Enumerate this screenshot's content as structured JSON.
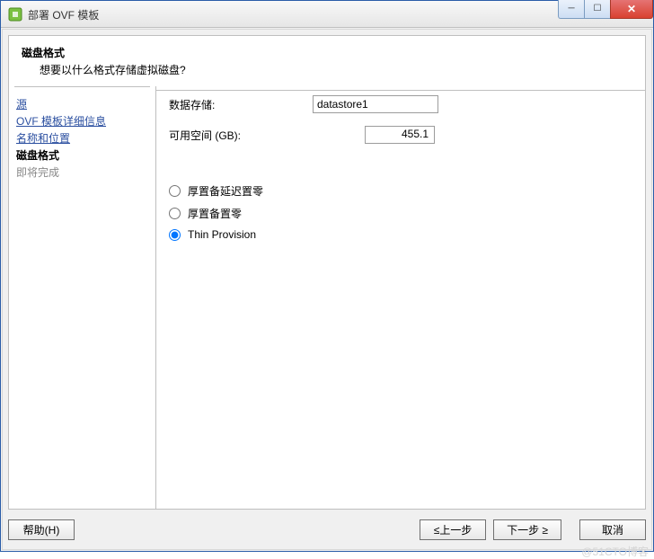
{
  "window": {
    "title": "部署 OVF 模板"
  },
  "header": {
    "title": "磁盘格式",
    "subtitle": "想要以什么格式存储虚拟磁盘?"
  },
  "sidebar": {
    "items": [
      {
        "label": "源",
        "state": "link"
      },
      {
        "label": "OVF 模板详细信息",
        "state": "link"
      },
      {
        "label": "名称和位置",
        "state": "link"
      },
      {
        "label": "磁盘格式",
        "state": "current"
      },
      {
        "label": "即将完成",
        "state": "disabled"
      }
    ]
  },
  "main": {
    "datastore_label": "数据存储:",
    "datastore_value": "datastore1",
    "freespace_label": "可用空间 (GB):",
    "freespace_value": "455.1",
    "radios": [
      {
        "label": "厚置备延迟置零",
        "selected": false
      },
      {
        "label": "厚置备置零",
        "selected": false
      },
      {
        "label": "Thin Provision",
        "selected": true
      }
    ]
  },
  "buttons": {
    "help": "帮助(H)",
    "back": "≤上一步",
    "next": "下一步 ≥",
    "cancel": "取消"
  },
  "watermark": "@51CTO博客"
}
